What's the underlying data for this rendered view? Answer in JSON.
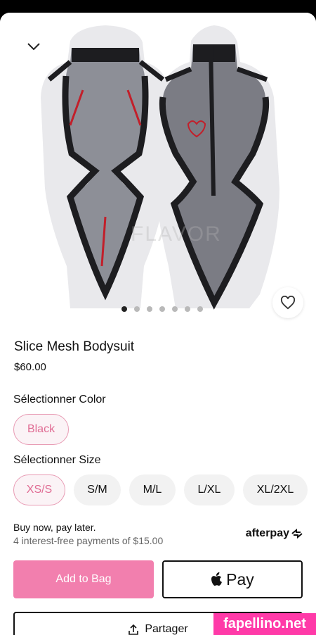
{
  "product": {
    "title": "Slice Mesh Bodysuit",
    "price": "$60.00",
    "image_watermark": "FLAVOR",
    "carousel": {
      "count": 7,
      "active_index": 0
    }
  },
  "color_section": {
    "label": "Sélectionner Color",
    "options": [
      "Black"
    ],
    "selected": "Black"
  },
  "size_section": {
    "label": "Sélectionner Size",
    "options": [
      "XS/S",
      "S/M",
      "M/L",
      "L/XL",
      "XL/2XL"
    ],
    "selected": "XS/S"
  },
  "bnpl": {
    "headline": "Buy now, pay later.",
    "detail": "4 interest-free payments of $15.00",
    "provider": "afterpay"
  },
  "actions": {
    "add_to_bag": "Add to Bag",
    "pay_label": "Pay",
    "share": "Partager"
  },
  "overlay_badge": "fapellino.net",
  "colors": {
    "accent_pink": "#f27fae",
    "selected_text": "#e06b93",
    "selected_border": "#e89bb4"
  }
}
